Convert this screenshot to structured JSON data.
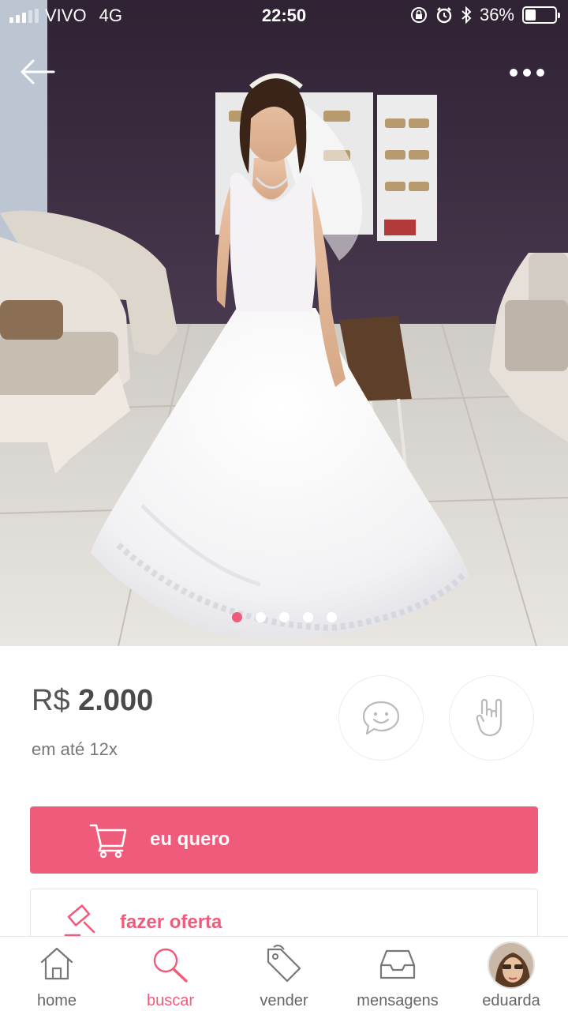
{
  "status_bar": {
    "carrier": "VIVO",
    "network": "4G",
    "time": "22:50",
    "battery": "36%",
    "battery_level": 0.36,
    "icons": [
      "signal-icon",
      "rotation-lock-icon",
      "alarm-icon",
      "bluetooth-icon",
      "battery-icon"
    ]
  },
  "hero": {
    "image_count": 5,
    "active_index": 0,
    "icons": {
      "back": "back-arrow-icon",
      "more": "more-options-icon"
    }
  },
  "product": {
    "currency": "R$",
    "price": "2.000",
    "installments": "em até 12x"
  },
  "actions": {
    "chat_icon": "chat-smile-icon",
    "rock_icon": "rock-hand-icon",
    "want_label": "eu quero",
    "offer_label": "fazer oferta"
  },
  "tabs": [
    {
      "label": "home",
      "icon": "home-icon",
      "active": false
    },
    {
      "label": "buscar",
      "icon": "search-icon",
      "active": true
    },
    {
      "label": "vender",
      "icon": "price-tag-icon",
      "active": false
    },
    {
      "label": "mensagens",
      "icon": "inbox-icon",
      "active": false
    },
    {
      "label": "eduarda",
      "icon": "avatar",
      "active": false
    }
  ],
  "colors": {
    "accent": "#ef5b7a",
    "text": "#4a4a4a",
    "muted": "#777777"
  }
}
